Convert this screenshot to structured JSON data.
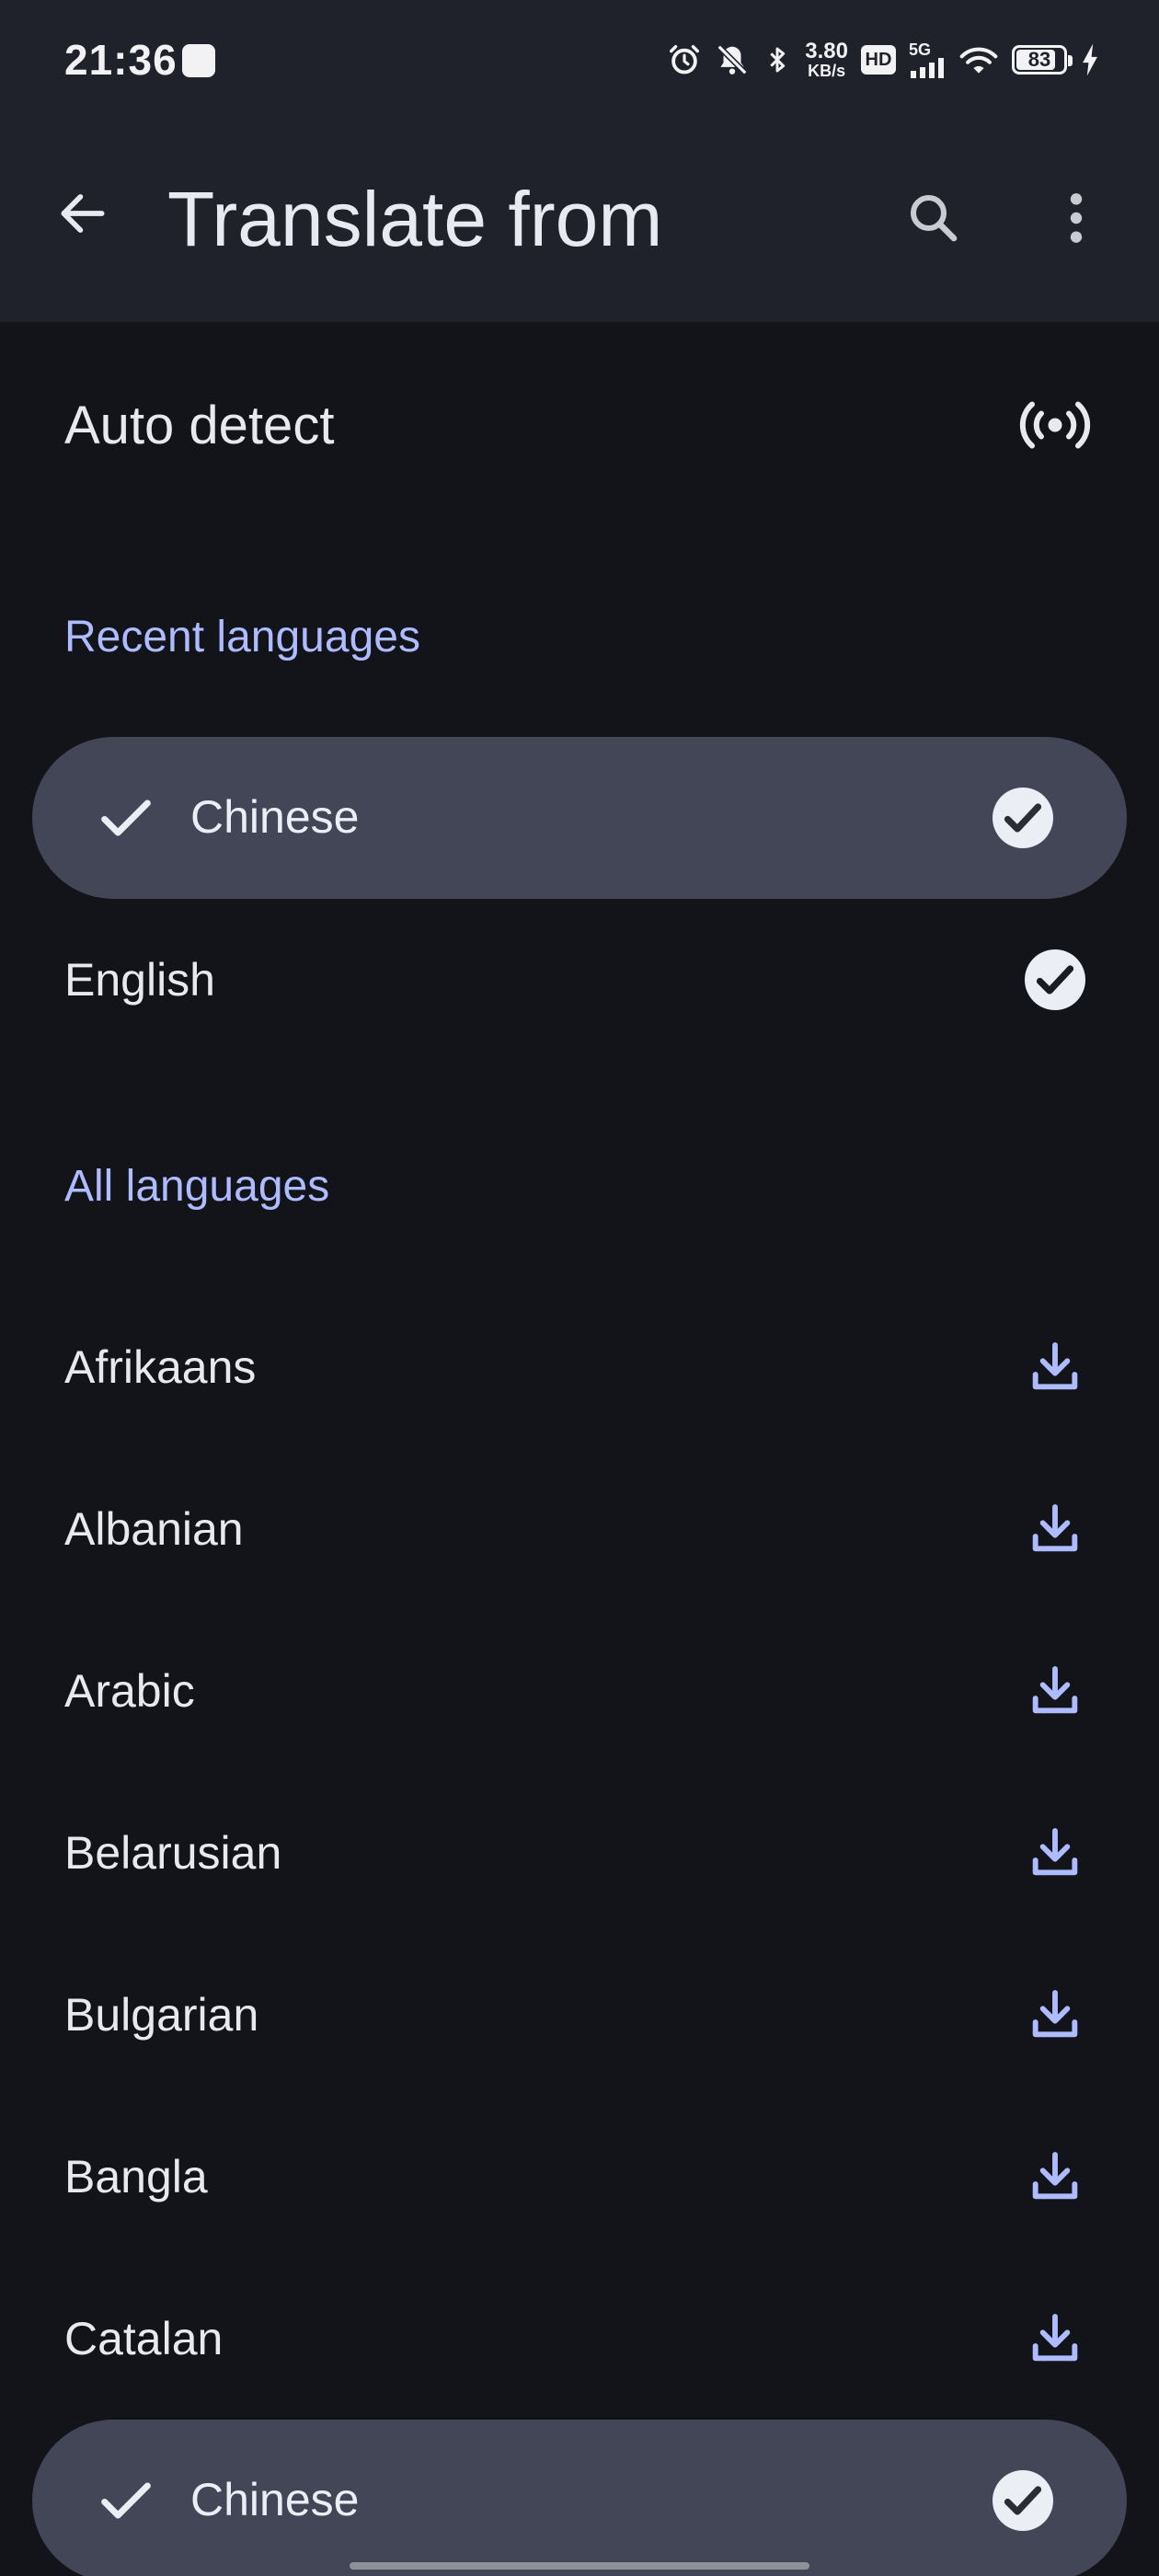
{
  "status_bar": {
    "time": "21:36",
    "speed_value": "3.80",
    "speed_unit": "KB/s",
    "hd_label": "HD",
    "network": "5G",
    "battery": "83"
  },
  "app_bar": {
    "title": "Translate from"
  },
  "auto_detect": {
    "label": "Auto detect"
  },
  "recent": {
    "header": "Recent languages",
    "items": [
      {
        "label": "Chinese",
        "selected": true
      },
      {
        "label": "English",
        "selected": false
      }
    ]
  },
  "all": {
    "header": "All languages",
    "items": [
      {
        "label": "Afrikaans"
      },
      {
        "label": "Albanian"
      },
      {
        "label": "Arabic"
      },
      {
        "label": "Belarusian"
      },
      {
        "label": "Bulgarian"
      },
      {
        "label": "Bangla"
      },
      {
        "label": "Catalan"
      },
      {
        "label": "Chinese",
        "selected": true
      }
    ]
  },
  "colors": {
    "background": "#131419",
    "surface": "#1f222b",
    "selected_bg": "#434657",
    "accent": "#aebcff",
    "text": "#e8e9ef"
  }
}
